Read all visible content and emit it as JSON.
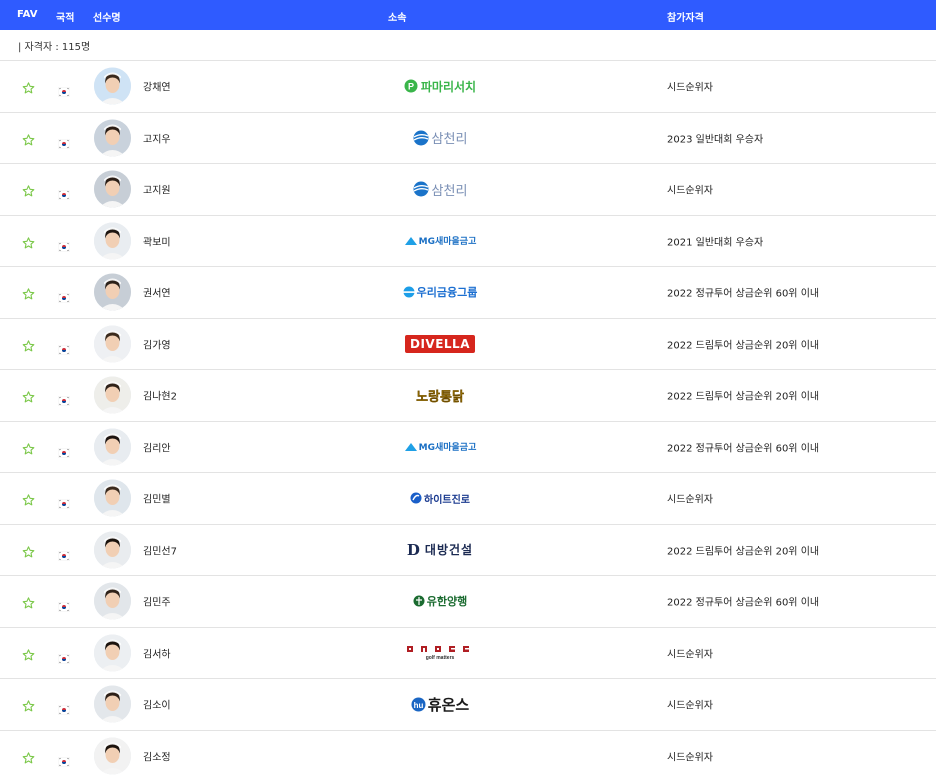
{
  "header": {
    "fav": "FAV",
    "country": "국적",
    "player": "선수명",
    "sponsor": "소속",
    "qualification": "참가자격"
  },
  "summary": {
    "count_label": "| 자격자 : 115명"
  },
  "players": [
    {
      "name": "강채연",
      "sponsor": "파마리서치",
      "sponsor_logo": "pharmaresearch-logo",
      "qualification": "시드순위자"
    },
    {
      "name": "고지우",
      "sponsor": "삼천리",
      "sponsor_logo": "samchully-logo",
      "qualification": "2023 일반대회 우승자"
    },
    {
      "name": "고지원",
      "sponsor": "삼천리",
      "sponsor_logo": "samchully-logo",
      "qualification": "시드순위자"
    },
    {
      "name": "곽보미",
      "sponsor": "MG새마을금고",
      "sponsor_logo": "mg-saemaul-logo",
      "qualification": "2021 일반대회 우승자"
    },
    {
      "name": "권서연",
      "sponsor": "우리금융그룹",
      "sponsor_logo": "woori-finance-logo",
      "qualification": "2022 정규투어 상금순위 60위 이내"
    },
    {
      "name": "김가영",
      "sponsor": "DIVELLA",
      "sponsor_logo": "divella-logo",
      "qualification": "2022 드림투어 상금순위 20위 이내"
    },
    {
      "name": "김나현2",
      "sponsor": "노랑통닭",
      "sponsor_logo": "norang-logo",
      "qualification": "2022 드림투어 상금순위 20위 이내"
    },
    {
      "name": "김리안",
      "sponsor": "MG새마을금고",
      "sponsor_logo": "mg-saemaul-logo",
      "qualification": "2022 정규투어 상금순위 60위 이내"
    },
    {
      "name": "김민별",
      "sponsor": "하이트진로",
      "sponsor_logo": "hitejinro-logo",
      "qualification": "시드순위자"
    },
    {
      "name": "김민선7",
      "sponsor": "대방건설",
      "sponsor_logo": "daebang-logo",
      "qualification": "2022 드림투어 상금순위 20위 이내"
    },
    {
      "name": "김민주",
      "sponsor": "유한양행",
      "sponsor_logo": "yuhan-logo",
      "qualification": "2022 정규투어 상금순위 60위 이내"
    },
    {
      "name": "김서하",
      "sponsor": "ONOFF golf matters",
      "sponsor_logo": "onoff-logo",
      "qualification": "시드순위자"
    },
    {
      "name": "김소이",
      "sponsor": "휴온스",
      "sponsor_logo": "huons-logo",
      "qualification": "시드순위자"
    },
    {
      "name": "김소정",
      "sponsor": "",
      "sponsor_logo": "",
      "qualification": "시드순위자"
    }
  ],
  "colors": {
    "header_bg": "#2f5bff",
    "star": "#7cc84a",
    "row_border": "#e3e3e3"
  }
}
